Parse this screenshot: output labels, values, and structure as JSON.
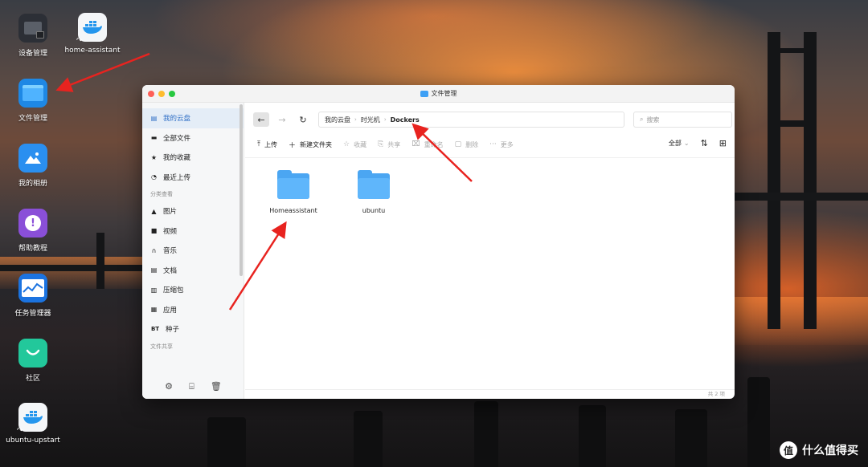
{
  "desktop": {
    "icons": [
      {
        "label": "设备管理",
        "icon": "device-manager-icon"
      },
      {
        "label": "home-assistant",
        "icon": "docker-icon"
      },
      {
        "label": "文件管理",
        "icon": "folder-icon"
      },
      {
        "label": "我的相册",
        "icon": "photo-album-icon"
      },
      {
        "label": "帮助教程",
        "icon": "help-icon"
      },
      {
        "label": "任务管理器",
        "icon": "task-manager-icon"
      },
      {
        "label": "社区",
        "icon": "community-icon"
      },
      {
        "label": "ubuntu-upstart",
        "icon": "docker-icon"
      }
    ]
  },
  "window": {
    "title": "文件管理",
    "traffic_colors": [
      "#fe5f57",
      "#febc2e",
      "#28c840"
    ]
  },
  "sidebar": {
    "items": [
      {
        "label": "我的云盘",
        "icon": "cloud-drive-icon",
        "glyph": "▤",
        "active": true
      },
      {
        "label": "全部文件",
        "icon": "all-files-icon",
        "glyph": "▬"
      },
      {
        "label": "我的收藏",
        "icon": "star-icon",
        "glyph": "★"
      },
      {
        "label": "最近上传",
        "icon": "clock-icon",
        "glyph": "◔"
      }
    ],
    "section_category": "分类查看",
    "categories": [
      {
        "label": "图片",
        "icon": "image-icon",
        "glyph": "▲"
      },
      {
        "label": "视频",
        "icon": "video-icon",
        "glyph": "■"
      },
      {
        "label": "音乐",
        "icon": "headphones-icon",
        "glyph": "∩"
      },
      {
        "label": "文档",
        "icon": "document-icon",
        "glyph": "▤"
      },
      {
        "label": "压缩包",
        "icon": "archive-icon",
        "glyph": "▥"
      },
      {
        "label": "应用",
        "icon": "apps-icon",
        "glyph": "▦"
      },
      {
        "label": "种子",
        "icon": "torrent-icon",
        "glyph": "BT"
      }
    ],
    "section_share": "文件共享"
  },
  "navigation": {
    "breadcrumb": [
      "我的云盘",
      "时光机",
      "Dockers"
    ],
    "search_placeholder": "搜索"
  },
  "toolbar": {
    "upload": "上传",
    "new_folder": "新建文件夹",
    "favorite": "收藏",
    "share": "共享",
    "rename": "重命名",
    "delete": "删除",
    "more": "更多",
    "filter": "全部"
  },
  "files": [
    {
      "name": "Homeassistant",
      "type": "folder"
    },
    {
      "name": "ubuntu",
      "type": "folder"
    }
  ],
  "status": {
    "count_text": "共 2 项"
  },
  "watermark": {
    "text": "什么值得买",
    "logo": "值"
  },
  "annotation_color": "#e8231f"
}
